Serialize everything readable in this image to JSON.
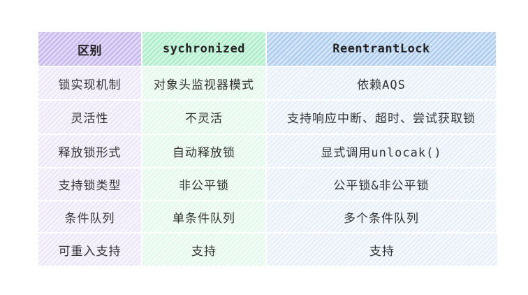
{
  "table": {
    "headers": [
      "区别",
      "sychronized",
      "ReentrantLock"
    ],
    "rows": [
      [
        "锁实现机制",
        "对象头监视器模式",
        "依赖AQS"
      ],
      [
        "灵活性",
        "不灵活",
        "支持响应中断、超时、尝试获取锁"
      ],
      [
        "释放锁形式",
        "自动释放锁",
        "显式调用unlocak()"
      ],
      [
        "支持锁类型",
        "非公平锁",
        "公平锁&非公平锁"
      ],
      [
        "条件队列",
        "单条件队列",
        "多个条件队列"
      ],
      [
        "可重入支持",
        "支持",
        "支持"
      ]
    ],
    "colors": {
      "col1_header": "#c6b4ec",
      "col2_header": "#a8ecc8",
      "col3_header": "#a9c8ee",
      "text": "#333333"
    }
  }
}
